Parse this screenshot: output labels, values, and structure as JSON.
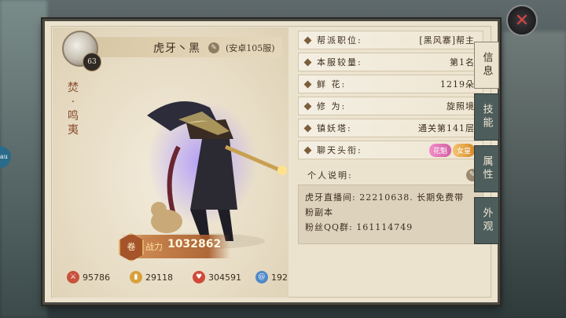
{
  "player": {
    "name": "虎牙丶黑",
    "server": "(安卓105服)",
    "level": "63",
    "vertical_title": "焚·鸣夷"
  },
  "power": {
    "emblem": "卷",
    "label": "战力",
    "value": "1032862"
  },
  "stats": [
    {
      "icon": "sword-icon",
      "value": "95786",
      "color": "#c8523d"
    },
    {
      "icon": "shield-icon",
      "value": "29118",
      "color": "#d9a03c"
    },
    {
      "icon": "heart-icon",
      "value": "304591",
      "color": "#d0493a"
    },
    {
      "icon": "swirl-icon",
      "value": "192",
      "color": "#4f89c8"
    }
  ],
  "info_rows": [
    {
      "label": "帮派职位:",
      "value": "[黑风寨]帮主"
    },
    {
      "label": "本服较量:",
      "value": "第1名"
    },
    {
      "label": "鲜   花:",
      "value": "1219朵"
    },
    {
      "label": "修   为:",
      "value": "旋照境"
    },
    {
      "label": "镇妖塔:",
      "value": "通关第141层"
    }
  ],
  "chat_title": {
    "label": "聊天头衔:",
    "badge_a": "花魁",
    "badge_b": "女皇"
  },
  "description": {
    "label": "个人说明:",
    "line1": "虎牙直播间: 22210638. 长期免费带",
    "line2": "粉副本",
    "line3": "粉丝QQ群: 161114749"
  },
  "tabs": [
    "信息",
    "技能",
    "属性",
    "外观"
  ],
  "side_button": "au"
}
